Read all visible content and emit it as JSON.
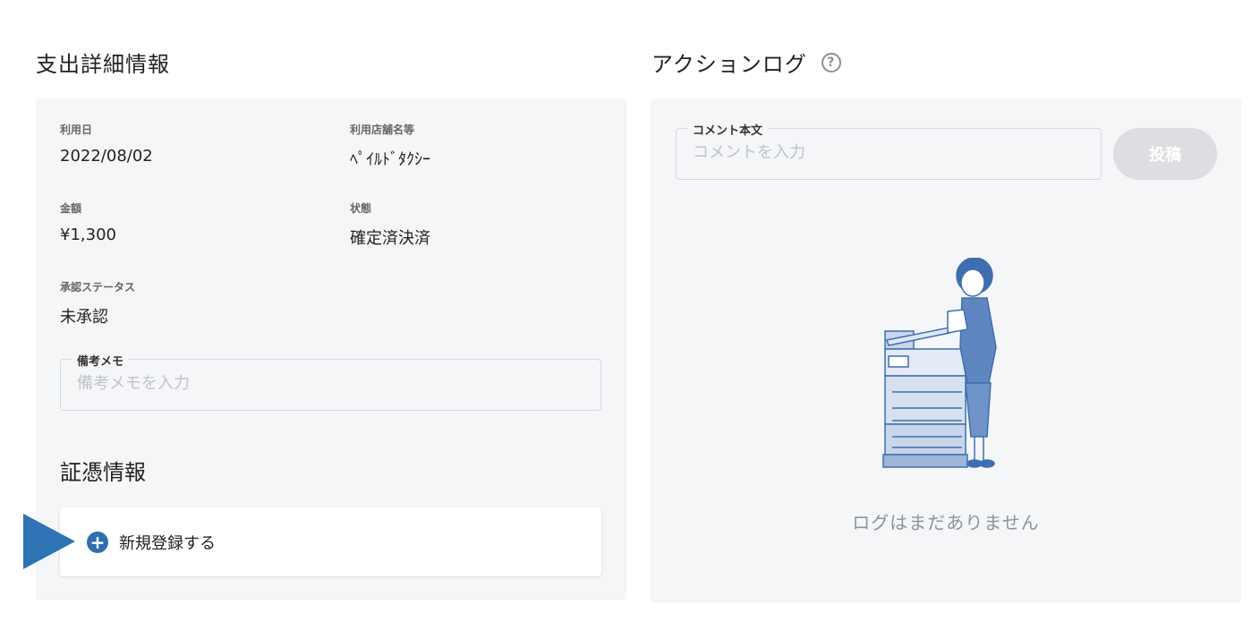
{
  "detail": {
    "title": "支出詳細情報",
    "usage_date_label": "利用日",
    "usage_date_value": "2022/08/02",
    "store_label": "利用店舗名等",
    "store_value": "ﾍﾟｲﾙﾄﾞﾀｸｼｰ",
    "amount_label": "金額",
    "amount_value": "¥1,300",
    "state_label": "状態",
    "state_value": "確定済決済",
    "approval_label": "承認ステータス",
    "approval_value": "未承認",
    "memo": {
      "legend": "備考メモ",
      "placeholder": "備考メモを入力",
      "value": ""
    }
  },
  "receipt": {
    "title": "証憑情報",
    "register_label": "新規登録する"
  },
  "action_log": {
    "title": "アクションログ",
    "help_icon": "question-circle-icon",
    "comment": {
      "legend": "コメント本文",
      "placeholder": "コメントを入力",
      "value": ""
    },
    "post_label": "投稿",
    "empty_message": "ログはまだありません"
  },
  "colors": {
    "accent": "#2e6eb1",
    "card_bg": "#f5f6f8",
    "post_disabled": "#dcdee1"
  }
}
